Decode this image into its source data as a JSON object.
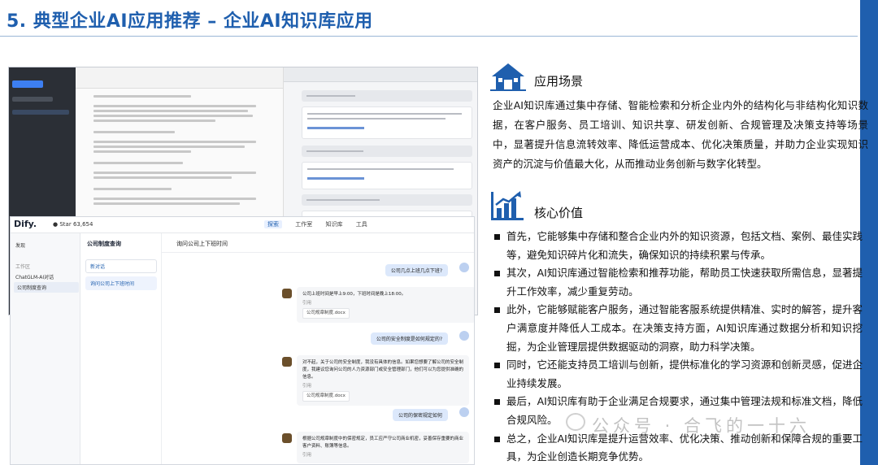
{
  "slide": {
    "title": "5. 典型企业AI应用推荐 – 企业AI知识库应用"
  },
  "scenario": {
    "heading": "应用场景",
    "icon": "house-icon",
    "text": "企业AI知识库通过集中存储、智能检索和分析企业内外的结构化与非结构化知识数据，在客户服务、员工培训、知识共享、研发创新、合规管理及决策支持等场景中，显著提升信息流转效率、降低运营成本、优化决策质量，并助力企业实现知识资产的沉淀与价值最大化，从而推动业务创新与数字化转型。"
  },
  "value": {
    "heading": "核心价值",
    "icon": "bar-chart-icon",
    "items": [
      "首先，它能够集中存储和整合企业内外的知识资源，包括文档、案例、最佳实践等，避免知识碎片化和流失，确保知识的持续积累与传承。",
      "其次，AI知识库通过智能检索和推荐功能，帮助员工快速获取所需信息，显著提升工作效率，减少重复劳动。",
      "此外，它能够赋能客户服务，通过智能客服系统提供精准、实时的解答，提升客户满意度并降低人工成本。在决策支持方面，AI知识库通过数据分析和知识挖掘，为企业管理层提供数据驱动的洞察，助力科学决策。",
      "同时，它还能支持员工培训与创新，提供标准化的学习资源和创新灵感，促进企业持续发展。",
      "最后，AI知识库有助于企业满足合规要求，通过集中管理法规和标准文档，降低合规风险。",
      "总之，企业AI知识库是提升运营效率、优化决策、推动创新和保障合规的重要工具，为企业创造长期竞争优势。"
    ]
  },
  "dify": {
    "logo": "Dify.",
    "star_label": "Star",
    "star_count": "63,654",
    "tabs": [
      "探索",
      "工作室",
      "知识库",
      "工具"
    ],
    "sidebar": {
      "discover": "发现",
      "workspace": "工作区",
      "apps": [
        "ChatGLM-AI对话",
        "公司制度查询"
      ]
    },
    "app_title": "公司制度查询",
    "app_items": [
      "新对话",
      "询问公司上下班时间"
    ],
    "chat_title": "询问公司上下班时间",
    "messages": [
      {
        "role": "user",
        "text": "公司几点上班几点下班?"
      },
      {
        "role": "bot",
        "text": "公司上班时间是早上9:00，下班时间是晚上18:00。",
        "cite": "引用",
        "file": "公司规章制度.docx"
      },
      {
        "role": "user",
        "text": "公司的安全制度是如何规定的?"
      },
      {
        "role": "bot",
        "text": "对不起，关于公司的安全制度，我没有具体的信息。如果您想要了解公司的安全制度，我建议您询问公司的人力资源部门或安全管理部门，他们可以为您提供准确的信息。",
        "cite": "引用",
        "file": "公司规章制度.docx"
      },
      {
        "role": "user",
        "text": "公司的保密规定如何"
      },
      {
        "role": "bot",
        "text": "根据公司规章制度中的保密规定，员工应严守公司商业机密，妥善保存重要的商业客户资料、账簿等信息。",
        "cite": "引用",
        "file": ""
      }
    ]
  },
  "watermark": "公众号 · 合飞的一十六"
}
